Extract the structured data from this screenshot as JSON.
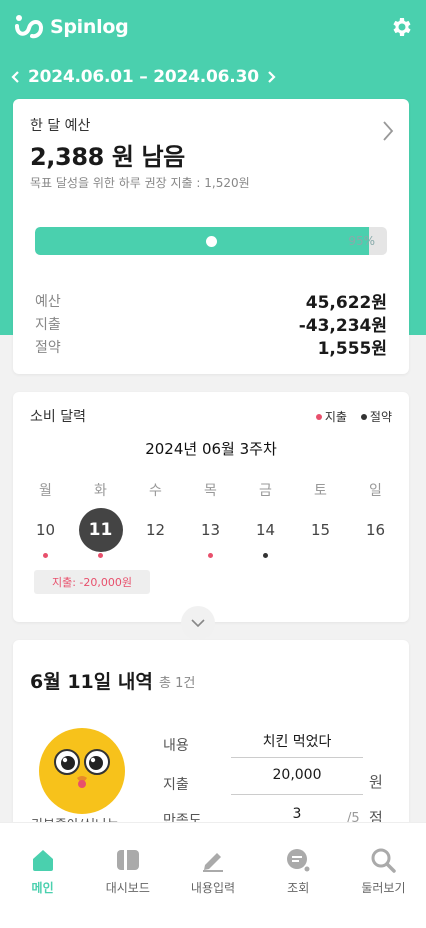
{
  "app": {
    "name": "Spinlog"
  },
  "colors": {
    "brand": "#4ad0ae",
    "expense": "#e8506c",
    "saving": "#333333"
  },
  "date_range": {
    "text": "2024.06.01 – 2024.06.30"
  },
  "budget": {
    "label": "한 달 예산",
    "remaining": "2,388 원 남음",
    "subtitle": "목표 달성을 위한 하루 권장 지출 : 1,520원",
    "progress_percent": 95,
    "progress_label": "95%",
    "rows": [
      {
        "label": "예산",
        "value": "45,622원"
      },
      {
        "label": "지출",
        "value": "-43,234원"
      },
      {
        "label": "절약",
        "value": "1,555원"
      }
    ]
  },
  "calendar": {
    "title": "소비 달력",
    "legend_expense": "지출",
    "legend_saving": "절약",
    "week_title": "2024년 06월 3주차",
    "days": [
      {
        "dow": "월",
        "date": "10",
        "marker": "expense"
      },
      {
        "dow": "화",
        "date": "11",
        "marker": "expense",
        "selected": true
      },
      {
        "dow": "수",
        "date": "12",
        "marker": ""
      },
      {
        "dow": "목",
        "date": "13",
        "marker": "expense"
      },
      {
        "dow": "금",
        "date": "14",
        "marker": "saving"
      },
      {
        "dow": "토",
        "date": "15",
        "marker": ""
      },
      {
        "dow": "일",
        "date": "16",
        "marker": ""
      }
    ],
    "selected_tag": "지출: -20,000원"
  },
  "detail": {
    "title": "6월 11일 내역",
    "count": "총 1건",
    "mascot_caption": "기분좋아/신나는",
    "fields": [
      {
        "label": "내용",
        "value": "치킨 먹었다",
        "unit": ""
      },
      {
        "label": "지출",
        "value": "20,000",
        "unit": "원"
      },
      {
        "label": "만족도",
        "value": "3",
        "unit": "점",
        "suffix": "/5"
      }
    ]
  },
  "nav": [
    {
      "label": "메인",
      "icon": "home-icon",
      "active": true
    },
    {
      "label": "대시보드",
      "icon": "dashboard-icon"
    },
    {
      "label": "내용입력",
      "icon": "pencil-icon"
    },
    {
      "label": "조회",
      "icon": "search-chat-icon"
    },
    {
      "label": "둘러보기",
      "icon": "magnifier-icon"
    }
  ]
}
